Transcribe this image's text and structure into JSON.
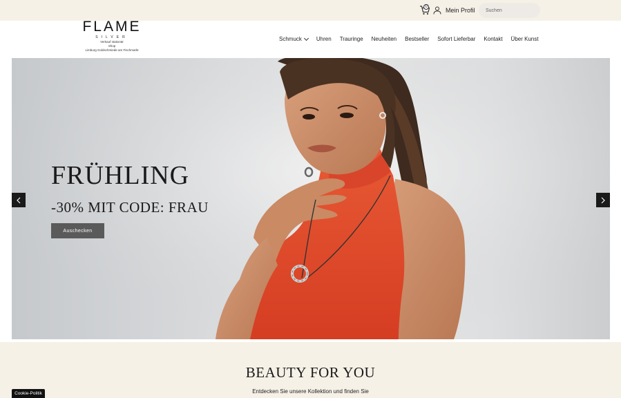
{
  "topbar": {
    "cart_count": "0",
    "profile_label": "Mein Profil",
    "search_placeholder": "Suchen"
  },
  "logo": {
    "title": "FLAME",
    "subtitle": "SILVER",
    "line1": "Verkauf stationär",
    "line2": "Shop",
    "line3": "Limburg Goldschmiede am Fischmarkt"
  },
  "nav": {
    "items": [
      "Schmuck",
      "Uhren",
      "Trauringe",
      "Neuheiten",
      "Bestseller",
      "Sofort Lieferbar",
      "Kontakt",
      "Über Kunst"
    ]
  },
  "hero": {
    "title": "FRÜHLING",
    "subtitle": "-30% MIT CODE: FRAU",
    "button": "Auschecken"
  },
  "section": {
    "title": "BEAUTY FOR YOU",
    "text": "Entdecken Sie unsere Kollektion und finden Sie"
  },
  "cookie": {
    "label": "Cookie-Politik"
  },
  "icons": {
    "cart": "cart-icon",
    "user": "user-icon",
    "prev": "chevron-left-icon",
    "next": "chevron-right-icon"
  },
  "colors": {
    "topbar_bg": "#f6f1e7",
    "dress": "#e2472a",
    "button": "#5a5a5a"
  }
}
